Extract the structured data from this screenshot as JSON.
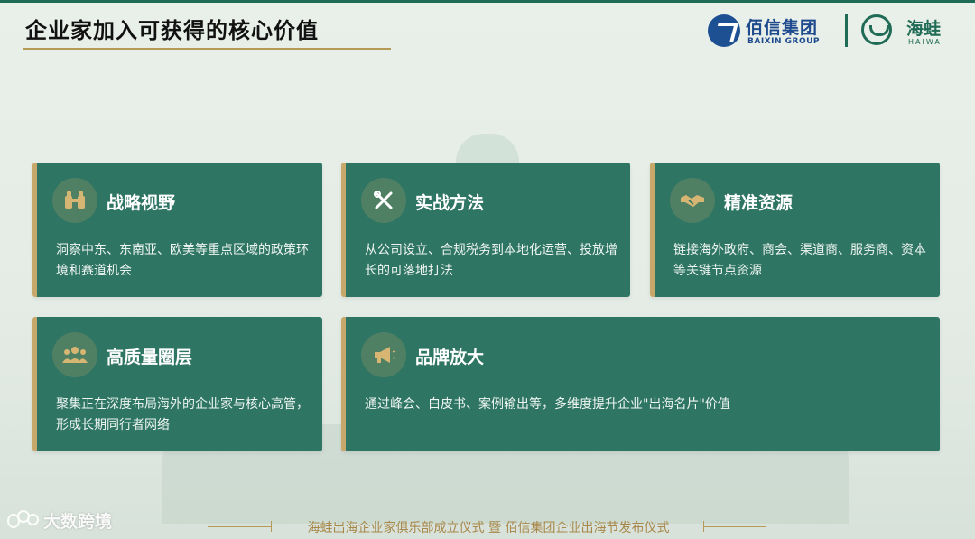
{
  "slide": {
    "title": "企业家加入可获得的核心价值"
  },
  "logos": {
    "baixin_cn": "佰信集团",
    "baixin_en": "BAIXIN GROUP",
    "haiwa_cn": "海蛙",
    "haiwa_en": "HAIWA"
  },
  "cards": [
    {
      "icon": "binoculars-icon",
      "heading": "战略视野",
      "desc": "洞察中东、东南亚、欧美等重点区域的政策环境和赛道机会"
    },
    {
      "icon": "tools-icon",
      "heading": "实战方法",
      "desc": "从公司设立、合规税务到本地化运营、投放增长的可落地打法"
    },
    {
      "icon": "handshake-icon",
      "heading": "精准资源",
      "desc": "链接海外政府、商会、渠道商、服务商、资本等关键节点资源"
    },
    {
      "icon": "people-group-icon",
      "heading": "高质量圈层",
      "desc": "聚集正在深度布局海外的企业家与核心高管，形成长期同行者网络"
    },
    {
      "icon": "megaphone-icon",
      "heading": "品牌放大",
      "desc": "通过峰会、白皮书、案例输出等，多维度提升企业\"出海名片\"价值"
    }
  ],
  "footer": {
    "text": "海蛙出海企业家俱乐部成立仪式 暨 佰信集团企业出海节发布仪式"
  },
  "watermark": {
    "text": "大数跨境"
  },
  "colors": {
    "card_bg": "#2f7563",
    "accent_gold": "#c8a86a",
    "brand_blue": "#1e4b8e",
    "brand_green": "#1f6b55"
  }
}
